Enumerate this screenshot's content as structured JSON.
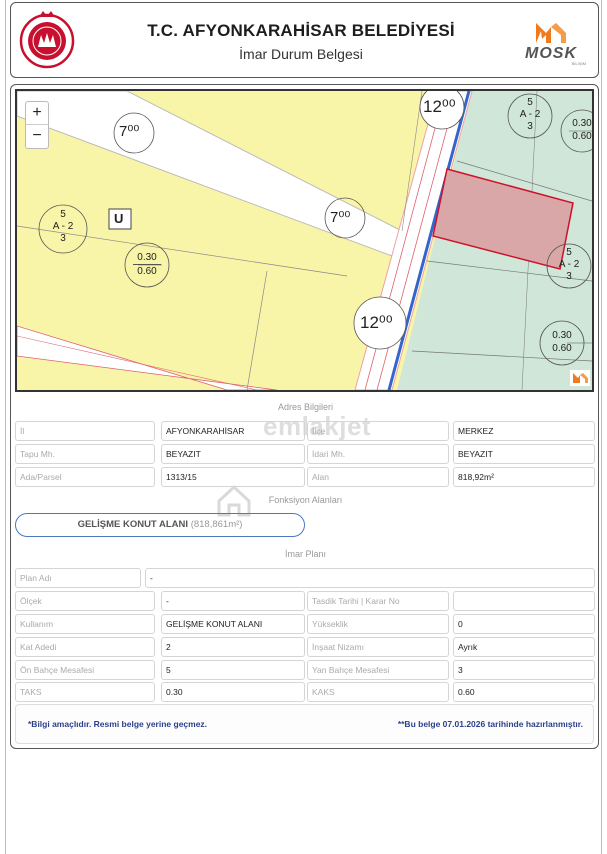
{
  "header": {
    "title": "T.C. AFYONKARAHİSAR BELEDİYESİ",
    "subtitle": "İmar Durum Belgesi",
    "brand_name": "MOSK",
    "brand_sub": "BİLİŞİM"
  },
  "map": {
    "zoom_in": "+",
    "zoom_out": "−",
    "labels": {
      "road_7_top": "7⁰⁰",
      "road_7_mid": "7⁰⁰",
      "road_12_top": "12⁰⁰",
      "road_12_mid": "12⁰⁰",
      "zone_u": "U",
      "left_zone_a": "5",
      "left_zone_b": "A - 2",
      "left_zone_c": "3",
      "left_ratio_a": "0.30",
      "left_ratio_b": "0.60",
      "right_top_zone_a": "5",
      "right_top_zone_b": "A - 2",
      "right_top_zone_c": "3",
      "right_top_ratio_a": "0.30",
      "right_top_ratio_b": "0.60",
      "right_mid_zone_a": "5",
      "right_mid_zone_b": "A - 2",
      "right_mid_zone_c": "3",
      "right_bot_ratio_a": "0.30",
      "right_bot_ratio_b": "0.60"
    },
    "colors": {
      "yellow_zone": "#f8f5a8",
      "green_zone": "#cfe6d8",
      "parcel": "#d9a7a7",
      "parcel_stroke": "#d0102a",
      "road_line": "#3366cc"
    }
  },
  "watermark": "emlakjet",
  "adres": {
    "section": "Adres Bilgileri",
    "il_label": "İl",
    "il_value": "AFYONKARAHİSAR",
    "ilce_label": "İlçe",
    "ilce_value": "MERKEZ",
    "tapu_label": "Tapu Mh.",
    "tapu_value": "BEYAZIT",
    "idari_label": "İdari Mh.",
    "idari_value": "BEYAZIT",
    "ada_label": "Ada/Parsel",
    "ada_value": "1313/15",
    "alan_label": "Alan",
    "alan_value": "818,92m²"
  },
  "fonksiyon": {
    "section": "Fonksiyon Alanları",
    "name": "GELİŞME KONUT ALANI",
    "area": "(818,861m²)"
  },
  "imar": {
    "section": "İmar Planı",
    "plan_adi_label": "Plan Adı",
    "plan_adi_value": "-",
    "olcek_label": "Ölçek",
    "olcek_value": "-",
    "tasdik_label": "Tasdik Tarihi | Karar No",
    "tasdik_value": "",
    "kullanim_label": "Kullanım",
    "kullanim_value": "GELİŞME KONUT ALANI",
    "yukseklik_label": "Yükseklik",
    "yukseklik_value": "0",
    "kat_label": "Kat Adedi",
    "kat_value": "2",
    "insaat_label": "İnşaat Nizamı",
    "insaat_value": "Ayrık",
    "on_label": "Ön Bahçe Mesafesi",
    "on_value": "5",
    "yan_label": "Yan Bahçe Mesafesi",
    "yan_value": "3",
    "taks_label": "TAKS",
    "taks_value": "0.30",
    "kaks_label": "KAKS",
    "kaks_value": "0.60"
  },
  "footer": {
    "note_left": "*Bilgi amaçlıdır. Resmi belge yerine geçmez.",
    "note_right": "**Bu belge 07.01.2026 tarihinde hazırlanmıştır."
  }
}
